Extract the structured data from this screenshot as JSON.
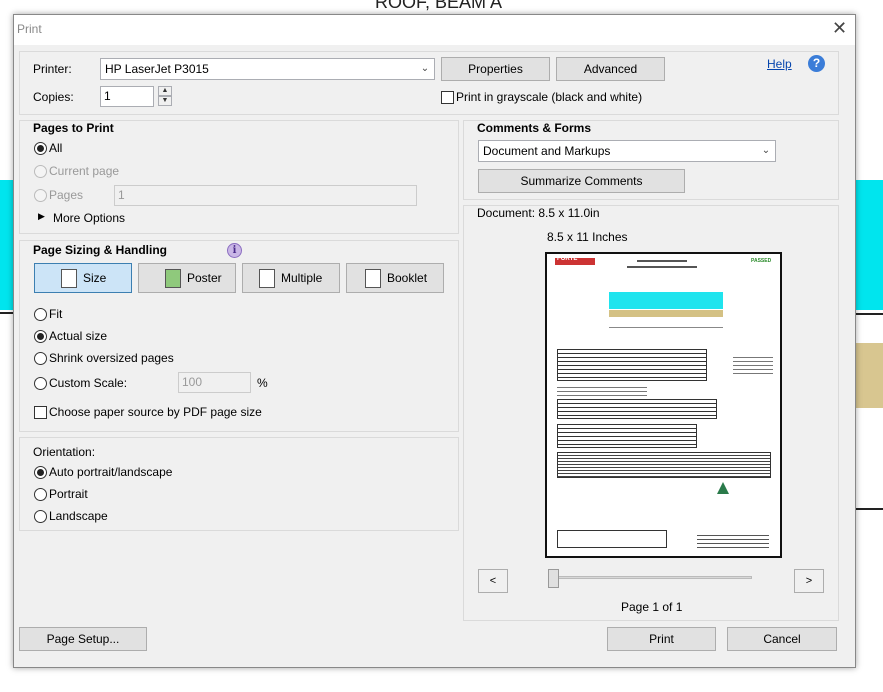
{
  "background": {
    "doc_title": "ROOF, BEAM A"
  },
  "window": {
    "title": "Print",
    "close_glyph": "✕"
  },
  "printer": {
    "label": "Printer:",
    "value": "HP LaserJet P3015",
    "properties": "Properties",
    "advanced": "Advanced",
    "help": "Help",
    "copies_label": "Copies:",
    "copies_value": "1",
    "grayscale": "Print in grayscale (black and white)"
  },
  "pages_to_print": {
    "title": "Pages to Print",
    "all": "All",
    "current": "Current page",
    "pages": "Pages",
    "pages_value": "1",
    "more": "More Options"
  },
  "sizing": {
    "title": "Page Sizing & Handling",
    "size": "Size",
    "poster": "Poster",
    "multiple": "Multiple",
    "booklet": "Booklet",
    "fit": "Fit",
    "actual": "Actual size",
    "shrink": "Shrink oversized pages",
    "custom": "Custom Scale:",
    "custom_value": "100",
    "percent": "%",
    "paper_source": "Choose paper source by PDF page size"
  },
  "orientation": {
    "title": "Orientation:",
    "auto": "Auto portrait/landscape",
    "portrait": "Portrait",
    "landscape": "Landscape"
  },
  "comments": {
    "title": "Comments & Forms",
    "value": "Document and Markups",
    "summarize": "Summarize Comments"
  },
  "preview": {
    "document": "Document: 8.5 x 11.0in",
    "size": "8.5 x 11 Inches",
    "page": "Page 1 of 1",
    "prev": "<",
    "next": ">",
    "logo_text": "FORTE",
    "passed": "PASSED"
  },
  "footer": {
    "page_setup": "Page Setup...",
    "print": "Print",
    "cancel": "Cancel"
  }
}
